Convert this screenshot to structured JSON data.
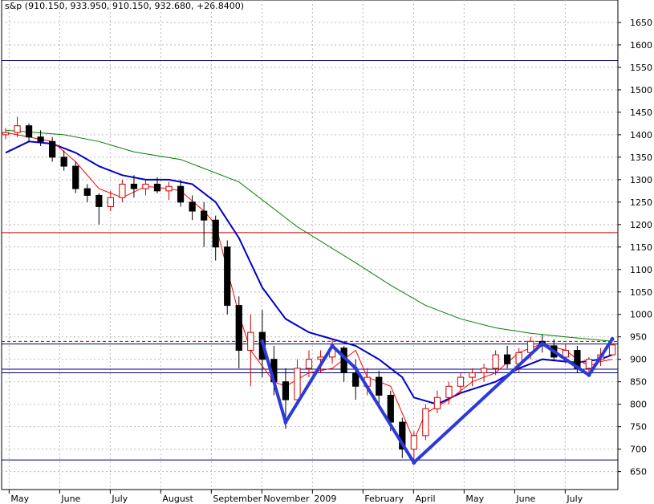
{
  "chart_data": {
    "type": "candlestick",
    "title": "s&p (910.150, 933.950, 910.150, 932.680, +26.8400)",
    "xlabel": "",
    "ylabel": "",
    "ylim": [
      610,
      1700
    ],
    "y_ticks": [
      650,
      700,
      750,
      800,
      850,
      900,
      950,
      1000,
      1050,
      1100,
      1150,
      1200,
      1250,
      1300,
      1350,
      1400,
      1450,
      1500,
      1550,
      1600,
      1650
    ],
    "x_tick_labels": [
      "May",
      "June",
      "July",
      "August",
      "September",
      "November",
      "2009",
      "February",
      "April",
      "May",
      "June",
      "July"
    ],
    "grid": "dashed",
    "horizontal_lines": [
      1565,
      1182,
      940,
      934,
      878,
      870,
      676
    ],
    "moving_averages": [
      {
        "color": "#008000",
        "points": [
          [
            0,
            1410
          ],
          [
            5,
            1400
          ],
          [
            8,
            1385
          ],
          [
            11,
            1362
          ],
          [
            15,
            1345
          ],
          [
            20,
            1295
          ],
          [
            25,
            1195
          ],
          [
            30,
            1115
          ],
          [
            33,
            1065
          ],
          [
            36,
            1020
          ],
          [
            39,
            990
          ],
          [
            42,
            970
          ],
          [
            45,
            958
          ],
          [
            48,
            950
          ],
          [
            50,
            945
          ],
          [
            52,
            940
          ]
        ]
      },
      {
        "color": "#0000cc",
        "points": [
          [
            0,
            1360
          ],
          [
            2,
            1385
          ],
          [
            4,
            1380
          ],
          [
            6,
            1360
          ],
          [
            8,
            1330
          ],
          [
            10,
            1310
          ],
          [
            12,
            1300
          ],
          [
            14,
            1300
          ],
          [
            16,
            1290
          ],
          [
            18,
            1250
          ],
          [
            20,
            1170
          ],
          [
            22,
            1060
          ],
          [
            24,
            990
          ],
          [
            26,
            960
          ],
          [
            28,
            945
          ],
          [
            30,
            930
          ],
          [
            32,
            900
          ],
          [
            34,
            860
          ],
          [
            35,
            815
          ],
          [
            37,
            800
          ],
          [
            39,
            825
          ],
          [
            42,
            850
          ],
          [
            44,
            880
          ],
          [
            46,
            900
          ],
          [
            48,
            895
          ],
          [
            49,
            893
          ],
          [
            51,
            900
          ],
          [
            52,
            910
          ]
        ]
      },
      {
        "color": "#ff0000",
        "points": [
          [
            0,
            1405
          ],
          [
            2,
            1395
          ],
          [
            4,
            1385
          ],
          [
            6,
            1340
          ],
          [
            8,
            1280
          ],
          [
            10,
            1260
          ],
          [
            12,
            1285
          ],
          [
            14,
            1280
          ],
          [
            15,
            1275
          ],
          [
            17,
            1230
          ],
          [
            18,
            1200
          ],
          [
            19,
            1100
          ],
          [
            20,
            1000
          ],
          [
            21,
            920
          ],
          [
            23,
            850
          ],
          [
            24,
            840
          ],
          [
            26,
            870
          ],
          [
            28,
            880
          ],
          [
            30,
            920
          ],
          [
            31,
            860
          ],
          [
            33,
            840
          ],
          [
            34,
            780
          ],
          [
            35,
            720
          ],
          [
            36,
            780
          ],
          [
            38,
            810
          ],
          [
            40,
            850
          ],
          [
            42,
            870
          ],
          [
            44,
            915
          ],
          [
            46,
            935
          ],
          [
            48,
            920
          ],
          [
            49,
            900
          ],
          [
            50,
            885
          ],
          [
            51,
            895
          ],
          [
            52,
            900
          ]
        ]
      }
    ],
    "pattern_lines": {
      "color": "#2b3ad8",
      "points": [
        [
          22,
          940
        ],
        [
          24,
          760
        ],
        [
          28,
          930
        ],
        [
          30,
          880
        ],
        [
          35,
          670
        ],
        [
          46,
          935
        ],
        [
          50,
          865
        ],
        [
          52,
          945
        ]
      ]
    },
    "candles": [
      {
        "x": 0,
        "o": 1400,
        "h": 1415,
        "l": 1390,
        "c": 1405
      },
      {
        "x": 1,
        "o": 1405,
        "h": 1440,
        "l": 1395,
        "c": 1420
      },
      {
        "x": 2,
        "o": 1420,
        "h": 1425,
        "l": 1385,
        "c": 1395
      },
      {
        "x": 3,
        "o": 1395,
        "h": 1410,
        "l": 1375,
        "c": 1385
      },
      {
        "x": 4,
        "o": 1385,
        "h": 1395,
        "l": 1340,
        "c": 1350
      },
      {
        "x": 5,
        "o": 1350,
        "h": 1365,
        "l": 1320,
        "c": 1330
      },
      {
        "x": 6,
        "o": 1330,
        "h": 1340,
        "l": 1270,
        "c": 1280
      },
      {
        "x": 7,
        "o": 1280,
        "h": 1290,
        "l": 1250,
        "c": 1265
      },
      {
        "x": 8,
        "o": 1265,
        "h": 1270,
        "l": 1200,
        "c": 1240
      },
      {
        "x": 9,
        "o": 1240,
        "h": 1275,
        "l": 1230,
        "c": 1260
      },
      {
        "x": 10,
        "o": 1260,
        "h": 1300,
        "l": 1250,
        "c": 1290
      },
      {
        "x": 11,
        "o": 1290,
        "h": 1310,
        "l": 1260,
        "c": 1280
      },
      {
        "x": 12,
        "o": 1280,
        "h": 1300,
        "l": 1265,
        "c": 1290
      },
      {
        "x": 13,
        "o": 1290,
        "h": 1305,
        "l": 1270,
        "c": 1275
      },
      {
        "x": 14,
        "o": 1275,
        "h": 1295,
        "l": 1255,
        "c": 1285
      },
      {
        "x": 15,
        "o": 1285,
        "h": 1300,
        "l": 1240,
        "c": 1250
      },
      {
        "x": 16,
        "o": 1250,
        "h": 1265,
        "l": 1210,
        "c": 1230
      },
      {
        "x": 17,
        "o": 1230,
        "h": 1250,
        "l": 1150,
        "c": 1210
      },
      {
        "x": 18,
        "o": 1210,
        "h": 1220,
        "l": 1120,
        "c": 1150
      },
      {
        "x": 19,
        "o": 1150,
        "h": 1165,
        "l": 1000,
        "c": 1020
      },
      {
        "x": 20,
        "o": 1020,
        "h": 1040,
        "l": 880,
        "c": 920
      },
      {
        "x": 21,
        "o": 920,
        "h": 1000,
        "l": 840,
        "c": 960
      },
      {
        "x": 22,
        "o": 960,
        "h": 1010,
        "l": 860,
        "c": 900
      },
      {
        "x": 23,
        "o": 900,
        "h": 930,
        "l": 820,
        "c": 850
      },
      {
        "x": 24,
        "o": 850,
        "h": 880,
        "l": 745,
        "c": 810
      },
      {
        "x": 25,
        "o": 810,
        "h": 900,
        "l": 800,
        "c": 880
      },
      {
        "x": 26,
        "o": 880,
        "h": 920,
        "l": 860,
        "c": 900
      },
      {
        "x": 27,
        "o": 900,
        "h": 920,
        "l": 870,
        "c": 905
      },
      {
        "x": 28,
        "o": 905,
        "h": 945,
        "l": 890,
        "c": 925
      },
      {
        "x": 29,
        "o": 925,
        "h": 930,
        "l": 850,
        "c": 870
      },
      {
        "x": 30,
        "o": 870,
        "h": 900,
        "l": 810,
        "c": 840
      },
      {
        "x": 31,
        "o": 840,
        "h": 880,
        "l": 820,
        "c": 860
      },
      {
        "x": 32,
        "o": 860,
        "h": 875,
        "l": 790,
        "c": 820
      },
      {
        "x": 33,
        "o": 820,
        "h": 830,
        "l": 740,
        "c": 760
      },
      {
        "x": 34,
        "o": 760,
        "h": 770,
        "l": 680,
        "c": 700
      },
      {
        "x": 35,
        "o": 700,
        "h": 740,
        "l": 676,
        "c": 730
      },
      {
        "x": 36,
        "o": 730,
        "h": 800,
        "l": 720,
        "c": 790
      },
      {
        "x": 37,
        "o": 790,
        "h": 830,
        "l": 780,
        "c": 815
      },
      {
        "x": 38,
        "o": 815,
        "h": 850,
        "l": 800,
        "c": 840
      },
      {
        "x": 39,
        "o": 840,
        "h": 870,
        "l": 825,
        "c": 860
      },
      {
        "x": 40,
        "o": 860,
        "h": 880,
        "l": 840,
        "c": 870
      },
      {
        "x": 41,
        "o": 870,
        "h": 890,
        "l": 850,
        "c": 880
      },
      {
        "x": 42,
        "o": 880,
        "h": 920,
        "l": 865,
        "c": 910
      },
      {
        "x": 43,
        "o": 910,
        "h": 930,
        "l": 880,
        "c": 890
      },
      {
        "x": 44,
        "o": 890,
        "h": 925,
        "l": 870,
        "c": 915
      },
      {
        "x": 45,
        "o": 915,
        "h": 950,
        "l": 900,
        "c": 940
      },
      {
        "x": 46,
        "o": 940,
        "h": 955,
        "l": 915,
        "c": 930
      },
      {
        "x": 47,
        "o": 930,
        "h": 945,
        "l": 895,
        "c": 905
      },
      {
        "x": 48,
        "o": 905,
        "h": 935,
        "l": 890,
        "c": 920
      },
      {
        "x": 49,
        "o": 920,
        "h": 930,
        "l": 870,
        "c": 880
      },
      {
        "x": 50,
        "o": 880,
        "h": 905,
        "l": 870,
        "c": 900
      },
      {
        "x": 51,
        "o": 900,
        "h": 925,
        "l": 885,
        "c": 910
      },
      {
        "x": 52,
        "o": 910,
        "h": 934,
        "l": 910,
        "c": 932
      }
    ]
  }
}
